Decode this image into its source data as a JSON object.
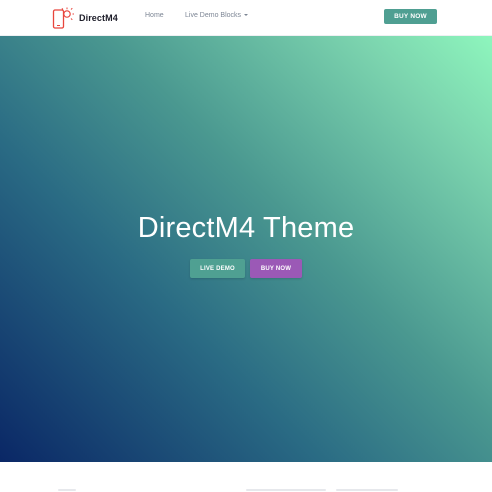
{
  "brand": {
    "name": "DirectM4",
    "logo_icon": "phone-sun-icon",
    "logo_color": "#e8453c"
  },
  "nav": {
    "home": "Home",
    "live_demo_blocks": "Live Demo Blocks",
    "buy_now": "BUY NOW"
  },
  "hero": {
    "title": "DirectM4 Theme",
    "live_demo": "LIVE DEMO",
    "buy_now": "BUY NOW",
    "gradient_start": "#0a2766",
    "gradient_end": "#8ef6bd"
  },
  "colors": {
    "accent_teal": "#4f9f92",
    "accent_purple": "#9b59b6"
  }
}
